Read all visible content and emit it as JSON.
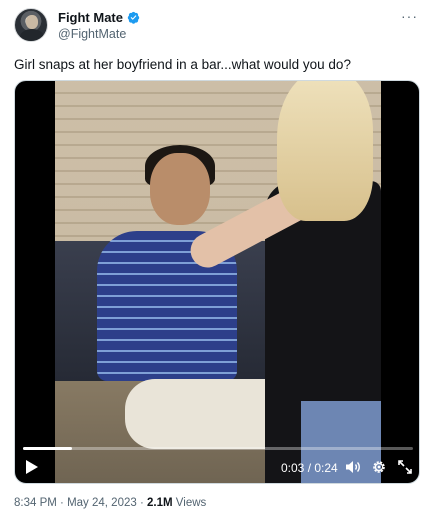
{
  "author": {
    "name": "Fight Mate",
    "handle": "@FightMate",
    "verified": true
  },
  "more_label": "···",
  "tweet": {
    "text": "Girl snaps at her boyfriend in a bar...what would you do?"
  },
  "video": {
    "time_display": "0:03 / 0:24",
    "progress": 0.125
  },
  "meta": {
    "time": "8:34 PM",
    "separator": "·",
    "date": "May 24, 2023",
    "views_count": "2.1M",
    "views_label": "Views"
  },
  "colors": {
    "verified_blue": "#1d9bf0",
    "text_primary": "#0f1419",
    "text_secondary": "#536471"
  }
}
